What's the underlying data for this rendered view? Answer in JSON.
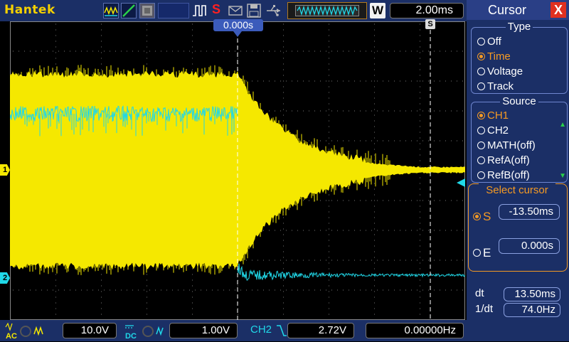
{
  "brand": "Hantek",
  "top": {
    "timebase": "2.00ms",
    "acq_badge": "W",
    "trigger_mark": "S"
  },
  "scope": {
    "trigger_position": "0.000s",
    "ch1_marker": "1",
    "ch2_marker": "2",
    "cursor_s_label": "S"
  },
  "panel": {
    "title": "Cursor",
    "close": "X",
    "type_title": "Type",
    "type_options": [
      "Off",
      "Time",
      "Voltage",
      "Track"
    ],
    "type_selected": "Time",
    "source_title": "Source",
    "source_options": [
      "CH1",
      "CH2",
      "MATH(off)",
      "RefA(off)",
      "RefB(off)"
    ],
    "source_selected": "CH1",
    "select_title": "Select cursor",
    "s_label": "S",
    "s_value": "-13.50ms",
    "e_label": "E",
    "e_value": "0.000s",
    "dt_label": "dt",
    "dt_value": "13.50ms",
    "inv_dt_label": "1/dt",
    "inv_dt_value": "74.0Hz"
  },
  "bottom": {
    "ch1_coupling": "AC",
    "ch1_scale": "10.0V",
    "ch2_coupling": "DC",
    "ch2_scale": "1.00V",
    "trig_source": "CH2",
    "trig_level": "2.72V",
    "frequency": "0.00000Hz"
  },
  "colors": {
    "ch1": "#f5e800",
    "ch2": "#20d8e8",
    "selection": "#f59a23",
    "panel_bg": "#1b2f66"
  }
}
